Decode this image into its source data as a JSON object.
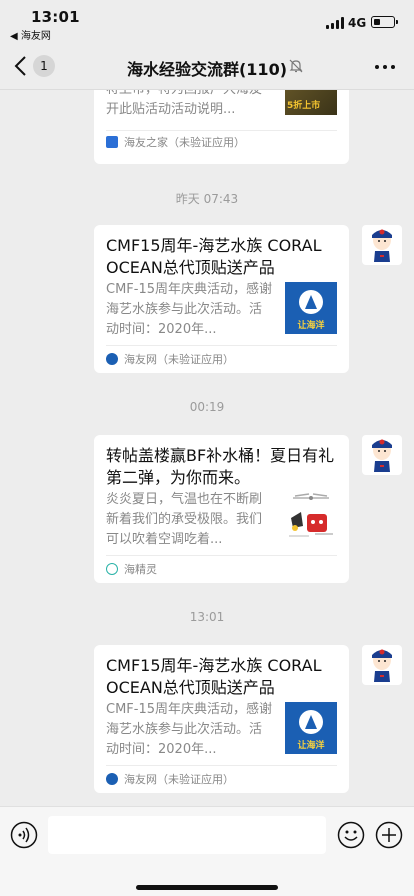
{
  "status_bar": {
    "time": "13:01",
    "back_app": "◀ 海友网",
    "network": "4G",
    "battery_level": 0.35
  },
  "nav": {
    "badge": "1",
    "title": "海水经验交流群(110)"
  },
  "messages": [
    {
      "desc": "将上市，特为回报广大海友开此贴活动活动说明...",
      "thumb_text": "5折上市",
      "source": "海友之家（未验证应用）"
    },
    {
      "timestamp": "昨天 07:43",
      "title": "CMF15周年-海艺水族 CORAL OCEAN总代顶贴送产品",
      "desc": "CMF-15周年庆典活动，感谢海艺水族参与此次活动。活动时间：2020年...",
      "thumb_text": "让海洋",
      "source": "海友网（未验证应用）"
    },
    {
      "timestamp": "00:19",
      "title": "转帖盖楼赢BF补水桶！夏日有礼第二弹，为你而来。",
      "desc": "炎炎夏日，气温也在不断刷新着我们的承受极限。我们可以吹着空调吃着...",
      "source": "海精灵"
    },
    {
      "timestamp": "13:01",
      "title": "CMF15周年-海艺水族 CORAL OCEAN总代顶贴送产品",
      "desc": "CMF-15周年庆典活动，感谢海艺水族参与此次活动。活动时间：2020年...",
      "thumb_text": "让海洋",
      "source": "海友网（未验证应用）"
    }
  ],
  "colors": {
    "background": "#ededed",
    "card": "#ffffff",
    "secondary_text": "#888888",
    "timestamp": "#9b9b9b",
    "source_blue": "#2b6fd6",
    "thumb_blue": "#1b5fb3"
  }
}
